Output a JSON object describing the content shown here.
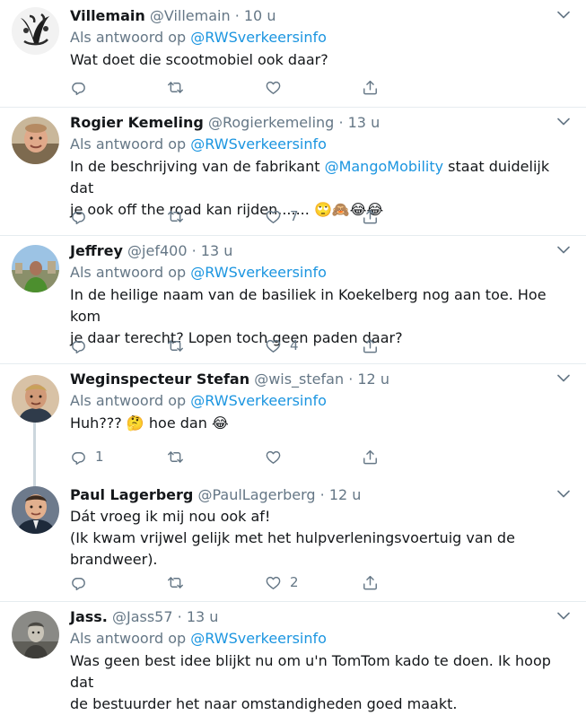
{
  "tweets": [
    {
      "name": "Villemain",
      "handle": "@Villemain",
      "time": "10 u",
      "reply_prefix": "Als antwoord op",
      "reply_handle": "@RWSverkeersinfo",
      "text_lines": [
        "Wat doet die scootmobiel ook daar?"
      ],
      "reply_count": "",
      "retweet_count": "",
      "like_count": ""
    },
    {
      "name": "Rogier Kemeling",
      "handle": "@Rogierkemeling",
      "time": "13 u",
      "reply_prefix": "Als antwoord op",
      "reply_handle": "@RWSverkeersinfo",
      "text_before": "In de beschrijving van de fabrikant ",
      "mention": "@MangoMobility",
      "text_after": " staat duidelijk dat",
      "text_line2": "je ook off the road kan rijden.......",
      "emojis": "🙄🙈😂😂",
      "reply_count": "",
      "retweet_count": "",
      "like_count": "7"
    },
    {
      "name": "Jeffrey",
      "handle": "@jef400",
      "time": "13 u",
      "reply_prefix": "Als antwoord op",
      "reply_handle": "@RWSverkeersinfo",
      "text_lines": [
        "In de heilige naam van de basiliek in Koekelberg nog aan toe. Hoe kom",
        "je daar terecht? Lopen toch geen paden daar?"
      ],
      "reply_count": "",
      "retweet_count": "",
      "like_count": "4"
    },
    {
      "name": "Weginspecteur Stefan",
      "handle": "@wis_stefan",
      "time": "12 u",
      "reply_prefix": "Als antwoord op",
      "reply_handle": "@RWSverkeersinfo",
      "text_before": "Huh??? ",
      "emoji_mid": "🤔",
      "text_after": " hoe dan ",
      "emoji_end": "😂",
      "reply_count": "1",
      "retweet_count": "",
      "like_count": ""
    },
    {
      "name": "Paul Lagerberg",
      "handle": "@PaulLagerberg",
      "time": "12 u",
      "text_lines": [
        "Dát vroeg ik mij nou ook af!",
        "(Ik kwam vrijwel gelijk met het hulpverleningsvoertuig van de",
        "brandweer)."
      ],
      "reply_count": "",
      "retweet_count": "",
      "like_count": "2"
    },
    {
      "name": "Jass.",
      "handle": "@Jass57",
      "time": "13 u",
      "reply_prefix": "Als antwoord op",
      "reply_handle": "@RWSverkeersinfo",
      "text_lines": [
        "Was geen best idee blijkt nu om u'n TomTom kado te doen. Ik hoop dat",
        "de bestuurder het naar omstandigheden goed maakt."
      ]
    }
  ],
  "dot": "·",
  "icons": {
    "reply": "reply-icon",
    "retweet": "retweet-icon",
    "like": "heart-icon",
    "share": "share-icon",
    "more": "chevron-down-icon"
  },
  "colors": {
    "link": "#1b95e0",
    "secondary_text": "#657786",
    "primary_text": "#14171a",
    "divider": "#e6ecf0",
    "thread_line": "#ccd6dd"
  }
}
